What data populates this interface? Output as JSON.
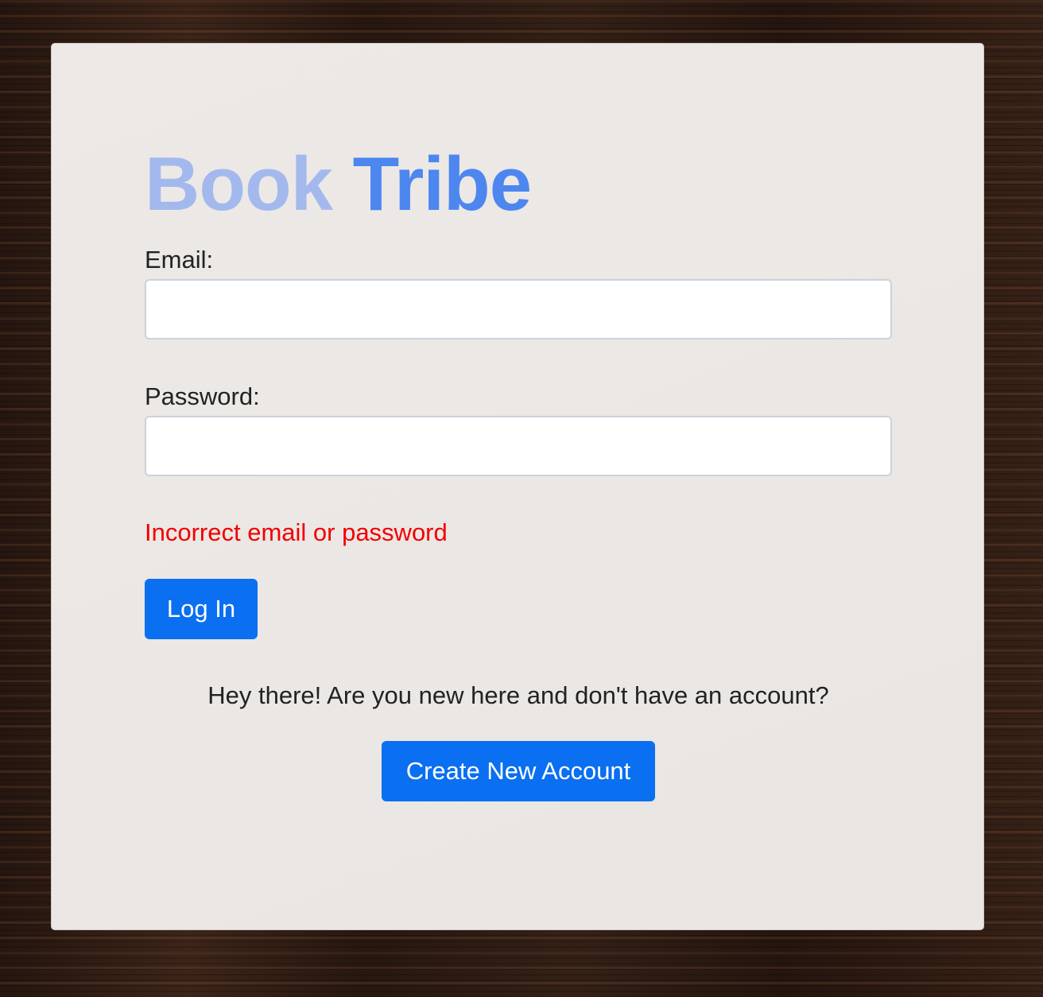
{
  "brand": {
    "part1": "Book",
    "part2": "Tribe",
    "colors": {
      "part1": "#a3b9ee",
      "part2": "#4d86ef"
    }
  },
  "form": {
    "email_label": "Email:",
    "email_value": "",
    "password_label": "Password:",
    "password_value": "",
    "error_message": "Incorrect email or password",
    "login_button": "Log In"
  },
  "signup": {
    "prompt": "Hey there! Are you new here and don't have an account?",
    "create_button": "Create New Account"
  },
  "colors": {
    "accent": "#0a6ff0",
    "error": "#f00000",
    "card_background": "#ebe7e4",
    "page_background": "#3a2418"
  }
}
